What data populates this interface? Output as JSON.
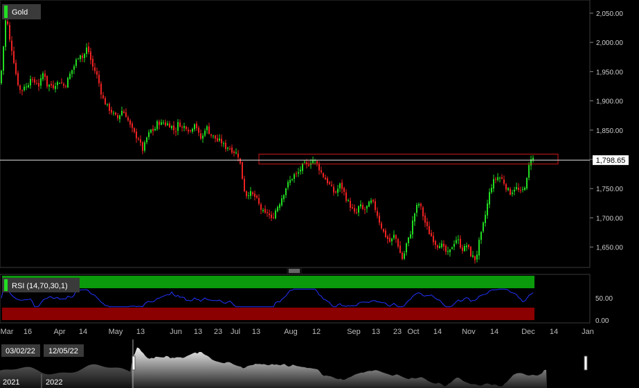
{
  "instrument": {
    "name": "Gold"
  },
  "price_label": "1,798.65",
  "rsi": {
    "label": "RSI (14,70,30,1)",
    "levels": [
      "50.00",
      "0.00"
    ],
    "overbought": 70,
    "oversold": 30
  },
  "x_axis_labels": [
    "Mar",
    "16",
    "Apr",
    "14",
    "May",
    "13",
    "Jun",
    "13",
    "23",
    "Jul",
    "13",
    "Aug",
    "12",
    "Sep",
    "13",
    "23",
    "Oct",
    "14",
    "Nov",
    "14",
    "Dec",
    "14",
    "Jan"
  ],
  "navigator": {
    "start_date": "03/02/22",
    "end_date": "12/05/22",
    "year_labels": [
      "2021",
      "2022"
    ]
  },
  "colors": {
    "up": "#22dd22",
    "down": "#ee2222",
    "rsi_line": "#2233ff",
    "overbought_zone": "#0b9a0b",
    "oversold_zone": "#8b0000",
    "zone_rect": "#d01818"
  },
  "chart_data": {
    "type": "candlestick",
    "title": "Gold",
    "ylim": [
      1615,
      2065
    ],
    "y_ticks": [
      "2,050.00",
      "2,000.00",
      "1,950.00",
      "1,900.00",
      "1,850.00",
      "1,800.00",
      "1,750.00",
      "1,700.00",
      "1,650.00"
    ],
    "current_price": 1798.65,
    "resistance_zone": [
      1792,
      1809
    ],
    "close_path": [
      [
        0,
        1935
      ],
      [
        3,
        1960
      ],
      [
        6,
        2010
      ],
      [
        9,
        2050
      ],
      [
        12,
        2020
      ],
      [
        15,
        1995
      ],
      [
        18,
        1985
      ],
      [
        21,
        1960
      ],
      [
        24,
        1940
      ],
      [
        27,
        1925
      ],
      [
        30,
        1915
      ],
      [
        33,
        1920
      ],
      [
        36,
        1930
      ],
      [
        39,
        1920
      ],
      [
        42,
        1935
      ],
      [
        45,
        1945
      ],
      [
        48,
        1925
      ],
      [
        51,
        1935
      ],
      [
        54,
        1930
      ],
      [
        57,
        1925
      ],
      [
        60,
        1940
      ],
      [
        63,
        1950
      ],
      [
        66,
        1940
      ],
      [
        69,
        1920
      ],
      [
        72,
        1930
      ],
      [
        75,
        1925
      ],
      [
        78,
        1925
      ],
      [
        81,
        1932
      ],
      [
        84,
        1930
      ],
      [
        87,
        1935
      ],
      [
        90,
        1928
      ],
      [
        93,
        1925
      ],
      [
        96,
        1930
      ],
      [
        99,
        1940
      ],
      [
        102,
        1948
      ],
      [
        105,
        1955
      ],
      [
        108,
        1962
      ],
      [
        111,
        1972
      ],
      [
        114,
        1978
      ],
      [
        117,
        1982
      ],
      [
        120,
        1970
      ],
      [
        123,
        1985
      ],
      [
        126,
        1992
      ],
      [
        129,
        1980
      ],
      [
        132,
        1965
      ],
      [
        135,
        1955
      ],
      [
        138,
        1950
      ],
      [
        141,
        1940
      ],
      [
        144,
        1925
      ],
      [
        147,
        1910
      ],
      [
        150,
        1900
      ],
      [
        153,
        1895
      ],
      [
        156,
        1888
      ],
      [
        159,
        1885
      ],
      [
        162,
        1880
      ],
      [
        165,
        1875
      ],
      [
        168,
        1872
      ],
      [
        171,
        1870
      ],
      [
        174,
        1880
      ],
      [
        177,
        1885
      ],
      [
        180,
        1878
      ],
      [
        183,
        1875
      ],
      [
        186,
        1862
      ],
      [
        189,
        1855
      ],
      [
        192,
        1848
      ],
      [
        195,
        1842
      ],
      [
        198,
        1838
      ],
      [
        201,
        1835
      ],
      [
        204,
        1820
      ],
      [
        207,
        1815
      ],
      [
        210,
        1830
      ],
      [
        213,
        1840
      ],
      [
        216,
        1845
      ],
      [
        219,
        1852
      ],
      [
        222,
        1848
      ],
      [
        225,
        1855
      ],
      [
        228,
        1865
      ],
      [
        231,
        1862
      ],
      [
        234,
        1860
      ],
      [
        237,
        1865
      ],
      [
        240,
        1858
      ],
      [
        243,
        1862
      ],
      [
        246,
        1858
      ],
      [
        249,
        1855
      ],
      [
        252,
        1848
      ],
      [
        255,
        1852
      ],
      [
        258,
        1865
      ],
      [
        261,
        1858
      ],
      [
        264,
        1852
      ],
      [
        267,
        1858
      ],
      [
        270,
        1855
      ],
      [
        273,
        1850
      ],
      [
        276,
        1848
      ],
      [
        279,
        1860
      ],
      [
        282,
        1865
      ],
      [
        285,
        1850
      ],
      [
        288,
        1838
      ],
      [
        291,
        1835
      ],
      [
        294,
        1842
      ],
      [
        297,
        1858
      ],
      [
        300,
        1852
      ],
      [
        303,
        1845
      ],
      [
        306,
        1840
      ],
      [
        309,
        1838
      ],
      [
        312,
        1835
      ],
      [
        315,
        1830
      ],
      [
        318,
        1832
      ],
      [
        321,
        1828
      ],
      [
        324,
        1822
      ],
      [
        327,
        1820
      ],
      [
        330,
        1822
      ],
      [
        333,
        1818
      ],
      [
        336,
        1815
      ],
      [
        339,
        1812
      ],
      [
        342,
        1810
      ],
      [
        345,
        1805
      ],
      [
        348,
        1785
      ],
      [
        351,
        1760
      ],
      [
        354,
        1742
      ],
      [
        357,
        1738
      ],
      [
        360,
        1745
      ],
      [
        363,
        1740
      ],
      [
        366,
        1738
      ],
      [
        369,
        1735
      ],
      [
        372,
        1728
      ],
      [
        375,
        1720
      ],
      [
        378,
        1712
      ],
      [
        381,
        1708
      ],
      [
        384,
        1705
      ],
      [
        387,
        1712
      ],
      [
        390,
        1700
      ],
      [
        393,
        1695
      ],
      [
        396,
        1708
      ],
      [
        399,
        1715
      ],
      [
        402,
        1722
      ],
      [
        405,
        1728
      ],
      [
        408,
        1738
      ],
      [
        411,
        1745
      ],
      [
        414,
        1755
      ],
      [
        417,
        1760
      ],
      [
        420,
        1765
      ],
      [
        423,
        1770
      ],
      [
        426,
        1775
      ],
      [
        429,
        1772
      ],
      [
        432,
        1780
      ],
      [
        435,
        1785
      ],
      [
        438,
        1790
      ],
      [
        441,
        1792
      ],
      [
        444,
        1788
      ],
      [
        447,
        1795
      ],
      [
        450,
        1798
      ],
      [
        453,
        1800
      ],
      [
        456,
        1795
      ],
      [
        459,
        1790
      ],
      [
        462,
        1782
      ],
      [
        465,
        1775
      ],
      [
        468,
        1770
      ],
      [
        471,
        1765
      ],
      [
        474,
        1760
      ],
      [
        477,
        1755
      ],
      [
        480,
        1748
      ],
      [
        483,
        1742
      ],
      [
        486,
        1745
      ],
      [
        489,
        1752
      ],
      [
        492,
        1758
      ],
      [
        495,
        1748
      ],
      [
        498,
        1740
      ],
      [
        501,
        1730
      ],
      [
        504,
        1725
      ],
      [
        507,
        1718
      ],
      [
        510,
        1712
      ],
      [
        513,
        1705
      ],
      [
        516,
        1710
      ],
      [
        519,
        1722
      ],
      [
        522,
        1718
      ],
      [
        525,
        1712
      ],
      [
        528,
        1715
      ],
      [
        531,
        1720
      ],
      [
        534,
        1725
      ],
      [
        537,
        1728
      ],
      [
        540,
        1722
      ],
      [
        543,
        1712
      ],
      [
        546,
        1702
      ],
      [
        549,
        1690
      ],
      [
        552,
        1682
      ],
      [
        555,
        1672
      ],
      [
        558,
        1668
      ],
      [
        561,
        1662
      ],
      [
        564,
        1658
      ],
      [
        567,
        1665
      ],
      [
        570,
        1672
      ],
      [
        573,
        1660
      ],
      [
        576,
        1650
      ],
      [
        579,
        1635
      ],
      [
        582,
        1628
      ],
      [
        585,
        1645
      ],
      [
        588,
        1660
      ],
      [
        591,
        1665
      ],
      [
        594,
        1680
      ],
      [
        597,
        1700
      ],
      [
        600,
        1712
      ],
      [
        603,
        1722
      ],
      [
        606,
        1725
      ],
      [
        609,
        1712
      ],
      [
        612,
        1700
      ],
      [
        615,
        1688
      ],
      [
        618,
        1680
      ],
      [
        621,
        1672
      ],
      [
        624,
        1668
      ],
      [
        627,
        1660
      ],
      [
        630,
        1655
      ],
      [
        633,
        1652
      ],
      [
        636,
        1658
      ],
      [
        639,
        1650
      ],
      [
        642,
        1645
      ],
      [
        645,
        1640
      ],
      [
        648,
        1638
      ],
      [
        651,
        1645
      ],
      [
        654,
        1655
      ],
      [
        657,
        1660
      ],
      [
        660,
        1665
      ],
      [
        663,
        1658
      ],
      [
        666,
        1650
      ],
      [
        669,
        1645
      ],
      [
        672,
        1650
      ],
      [
        675,
        1655
      ],
      [
        678,
        1642
      ],
      [
        681,
        1635
      ],
      [
        684,
        1632
      ],
      [
        687,
        1628
      ],
      [
        690,
        1645
      ],
      [
        693,
        1665
      ],
      [
        696,
        1675
      ],
      [
        699,
        1695
      ],
      [
        702,
        1710
      ],
      [
        705,
        1730
      ],
      [
        708,
        1748
      ],
      [
        711,
        1758
      ],
      [
        714,
        1765
      ],
      [
        717,
        1768
      ],
      [
        720,
        1770
      ],
      [
        723,
        1768
      ],
      [
        726,
        1765
      ],
      [
        729,
        1758
      ],
      [
        732,
        1750
      ],
      [
        735,
        1745
      ],
      [
        738,
        1742
      ],
      [
        741,
        1748
      ],
      [
        744,
        1752
      ],
      [
        747,
        1750
      ],
      [
        750,
        1745
      ],
      [
        753,
        1742
      ],
      [
        756,
        1750
      ],
      [
        759,
        1758
      ],
      [
        762,
        1768
      ],
      [
        765,
        1798
      ],
      [
        768,
        1806
      ],
      [
        771,
        1798.65
      ]
    ]
  }
}
